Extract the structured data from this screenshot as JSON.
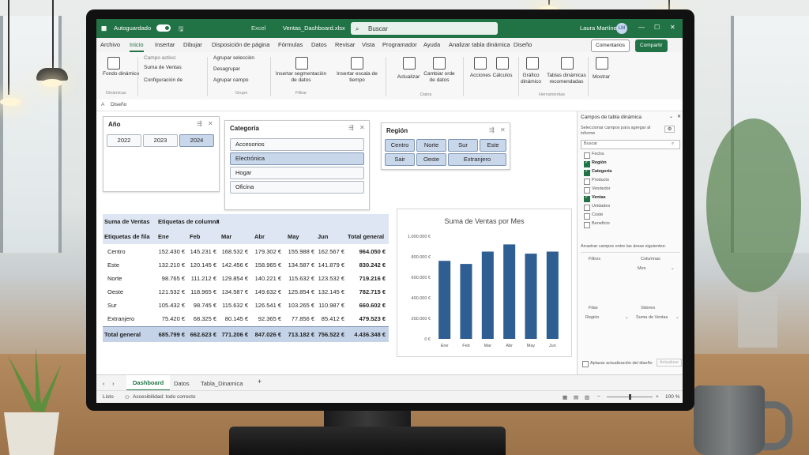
{
  "titlebar": {
    "autosave": "Autoguardado",
    "filename": "Ventas_Dashboard.xlsx",
    "filesuffix": "Excel",
    "search_placeholder": "Buscar",
    "user": "Laura Martínez",
    "user_initials": "LM"
  },
  "tabs": [
    "Archivo",
    "Inicio",
    "Insertar",
    "Dibujar",
    "Disposición de página",
    "Fórmulas",
    "Datos",
    "Revisar",
    "Vista",
    "Programador",
    "Ayuda",
    "Analizar tabla dinámica",
    "Diseño"
  ],
  "ribbon_buttons": {
    "comments": "Comentarios",
    "share": "Compartir"
  },
  "ribbon": {
    "pivot_name": "Fondo dinámico",
    "group_dinamica": "Dinámicas",
    "active_field_label": "Campo activo:",
    "active_field_value": "Suma de Ventas",
    "field_settings": "Configuración de",
    "group_selection": "Agrupar selección",
    "ungroup": "Desagrupar",
    "group_field": "Agrupar campo",
    "group_label": "Grupo",
    "insert_slicer": "Insertar segmentación de datos",
    "insert_timeline": "Insertar escala de tiempo",
    "filter_label": "Filtrar",
    "refresh": "Actualizar",
    "change_source": "Cambiar orde de datos",
    "data_label": "Datos",
    "actions": "Acciones",
    "calculations": "Cálculos",
    "pivot_chart": "Gráfico dinámico",
    "recommended": "Tablas dinámicas recomendadas",
    "show": "Mostrar",
    "tools_label": "Herramientas"
  },
  "formula": {
    "namebox": "Diseño"
  },
  "slicers": {
    "year": {
      "title": "Año",
      "items": [
        "2022",
        "2023",
        "2024"
      ]
    },
    "category": {
      "title": "Categoría",
      "items": [
        "Accesorios",
        "Electrónica",
        "Hogar",
        "Oficina"
      ]
    },
    "region": {
      "title": "Región",
      "items": [
        "Centro",
        "Norte",
        "Sur",
        "Este",
        "Sair",
        "Oeste",
        "Extranjero"
      ]
    }
  },
  "pivot": {
    "values_label": "Suma de Ventas",
    "col_labels": "Etiquetas de columna",
    "row_labels": "Etiquetas de fila",
    "months": [
      "Ene",
      "Feb",
      "Mar",
      "Abr",
      "May",
      "Jun"
    ],
    "total_header": "Total general",
    "rows": [
      {
        "label": "Centro",
        "vals": [
          "152.430 €",
          "145.231 €",
          "168.532 €",
          "179.302 €",
          "155.988 €",
          "162.567 €"
        ],
        "total": "964.050 €"
      },
      {
        "label": "Este",
        "vals": [
          "132.210 €",
          "120.145 €",
          "142.456 €",
          "158.965 €",
          "134.587 €",
          "141.879 €"
        ],
        "total": "830.242 €"
      },
      {
        "label": "Norte",
        "vals": [
          "98.765 €",
          "111.212 €",
          "129.854 €",
          "140.221 €",
          "115.632 €",
          "123.532 €"
        ],
        "total": "719.216 €"
      },
      {
        "label": "Oeste",
        "vals": [
          "121.532 €",
          "118.965 €",
          "134.587 €",
          "149.632 €",
          "125.854 €",
          "132.145 €"
        ],
        "total": "782.715 €"
      },
      {
        "label": "Sur",
        "vals": [
          "105.432 €",
          "98.745 €",
          "115.632 €",
          "126.541 €",
          "103.265 €",
          "110.987 €"
        ],
        "total": "660.602 €"
      },
      {
        "label": "Extranjero",
        "vals": [
          "75.420 €",
          "68.325 €",
          "80.145 €",
          "92.365 €",
          "77.856 €",
          "85.412 €"
        ],
        "total": "479.523 €"
      }
    ],
    "grand_label": "Total general",
    "grand_vals": [
      "685.799 €",
      "662.623 €",
      "771.206 €",
      "847.026 €",
      "713.182 €",
      "756.522 €"
    ],
    "grand_total": "4.436.348 €"
  },
  "chart_data": {
    "type": "bar",
    "title": "Suma de Ventas por Mes",
    "categories": [
      "Ene",
      "Feb",
      "Mar",
      "Abr",
      "May",
      "Jun"
    ],
    "values": [
      760000,
      730000,
      850000,
      920000,
      830000,
      850000
    ],
    "yticks": [
      "0 €",
      "200.000 €",
      "400.000 €",
      "600.000 €",
      "800.000 €",
      "1.000.000 €"
    ],
    "ylim": [
      0,
      1000000
    ],
    "color": "#2f5e93",
    "grid": false
  },
  "field_pane": {
    "title": "Campos de tabla dinámica",
    "subtitle": "Seleccionar campos para agregar al informe",
    "search_placeholder": "Buscar",
    "fields": [
      {
        "name": "Fecha",
        "checked": false
      },
      {
        "name": "Región",
        "checked": true
      },
      {
        "name": "Categoría",
        "checked": true
      },
      {
        "name": "Producto",
        "checked": false
      },
      {
        "name": "Vendedor",
        "checked": false
      },
      {
        "name": "Ventas",
        "checked": true
      },
      {
        "name": "Unidades",
        "checked": false
      },
      {
        "name": "Coste",
        "checked": false
      },
      {
        "name": "Beneficio",
        "checked": false
      }
    ],
    "drag_hint": "Arrastrar campos entre las áreas siguientes:",
    "filters": "Filtros",
    "columns": "Columnas",
    "columns_value": "Mes",
    "rows": "Filas",
    "rows_value": "Región",
    "values": "Valores",
    "values_value": "Suma de Ventas",
    "defer": "Aplazar actualización del diseño",
    "update": "Actualizar"
  },
  "sheet_tabs": [
    "Dashboard",
    "Datos",
    "Tabla_Dinamica"
  ],
  "status": {
    "ready": "Listo",
    "accessibility": "Accesibilidad: todo correcto",
    "zoom": "100 %"
  }
}
